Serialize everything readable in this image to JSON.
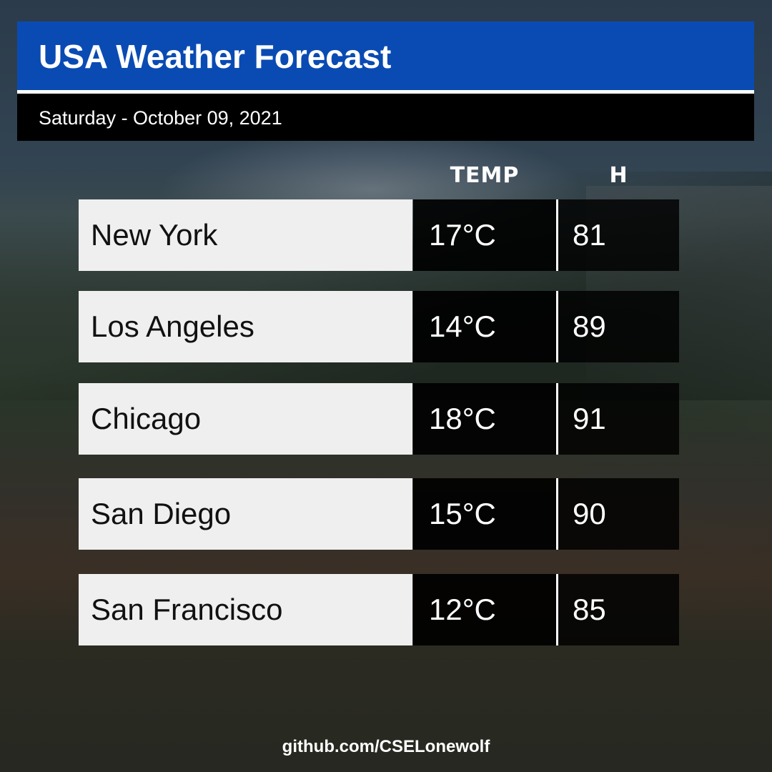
{
  "header": {
    "title": "USA Weather Forecast",
    "date": "Saturday - October 09, 2021"
  },
  "columns": {
    "temp": "TEMP",
    "humidity": "H"
  },
  "rows": [
    {
      "city": "New York",
      "temp": "17°C",
      "humidity": "81"
    },
    {
      "city": "Los Angeles",
      "temp": "14°C",
      "humidity": "89"
    },
    {
      "city": "Chicago",
      "temp": "18°C",
      "humidity": "91"
    },
    {
      "city": "San Diego",
      "temp": "15°C",
      "humidity": "90"
    },
    {
      "city": "San Francisco",
      "temp": "12°C",
      "humidity": "85"
    }
  ],
  "footer": {
    "credit": "github.com/CSELonewolf"
  },
  "colors": {
    "title_bar": "#0a4bb3",
    "date_bar": "#000000",
    "city_cell": "#efefef"
  }
}
